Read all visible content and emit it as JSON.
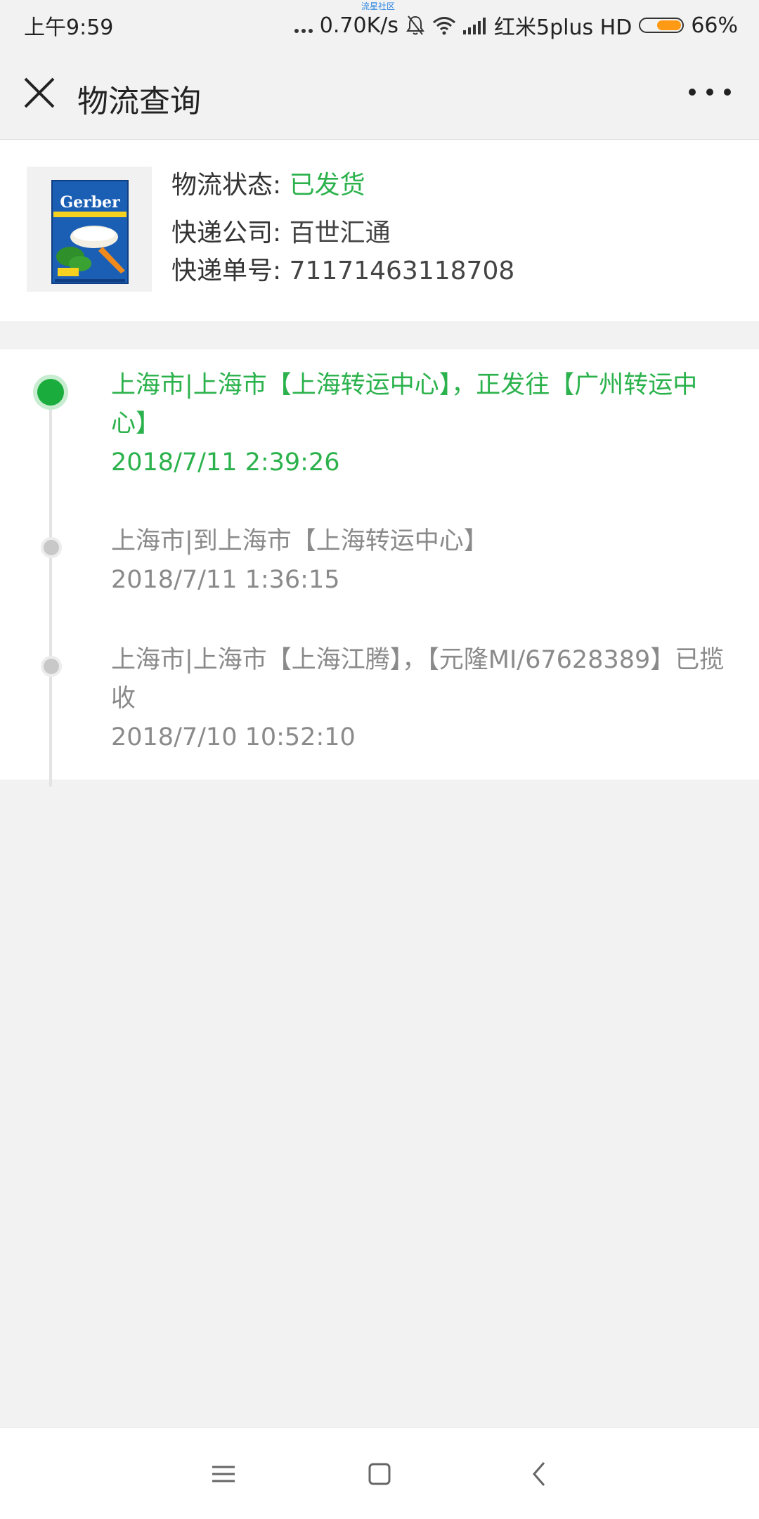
{
  "status_bar": {
    "time": "上午9:59",
    "watermark": "流星社区",
    "network_speed": "0.70K/s",
    "carrier": "红米5plus HD",
    "battery": "66%",
    "battery_level_percent": 66
  },
  "header": {
    "title": "物流查询",
    "close_icon": "close-icon",
    "more_icon": "more-icon"
  },
  "info": {
    "status_label": "物流状态:",
    "status_value": "已发货",
    "company_label": "快递公司:",
    "company_value": "百世汇通",
    "tracking_label": "快递单号:",
    "tracking_value": "71171463118708",
    "thumbnail_brand": "Gerber"
  },
  "timeline": [
    {
      "description": "上海市|上海市【上海转运中心】，正发往【广州转运中心】",
      "time": "2018/7/11 2:39:26"
    },
    {
      "description": "上海市|到上海市【上海转运中心】",
      "time": "2018/7/11 1:36:15"
    },
    {
      "description": "上海市|上海市【上海江腾】，【元隆MI/67628389】已揽收",
      "time": "2018/7/10 10:52:10"
    }
  ],
  "colors": {
    "accent_green": "#2bb24c",
    "dot_green": "#1aad3d",
    "battery_orange": "#ff9a14",
    "background": "#f2f2f2"
  },
  "bottom_nav": {
    "menu_icon": "menu-icon",
    "home_icon": "home-icon",
    "back_icon": "back-icon"
  }
}
